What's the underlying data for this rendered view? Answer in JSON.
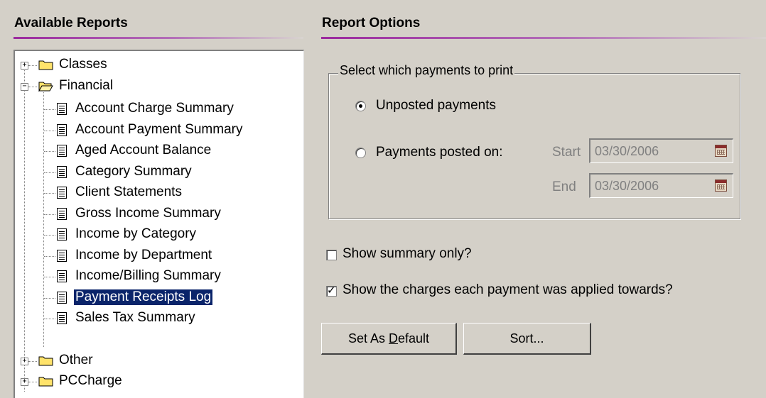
{
  "left_panel": {
    "title": "Available Reports"
  },
  "right_panel": {
    "title": "Report Options"
  },
  "tree": {
    "classes": "Classes",
    "financial": "Financial",
    "financial_items": [
      "Account Charge Summary",
      "Account Payment Summary",
      "Aged Account Balance",
      "Category Summary",
      "Client Statements",
      "Gross Income Summary",
      "Income by Category",
      "Income by Department",
      "Income/Billing Summary",
      "Payment Receipts Log",
      "Sales Tax Summary"
    ],
    "selected": "Payment Receipts Log",
    "other": "Other",
    "pccharge": "PCCharge"
  },
  "payments_group": {
    "title": "Select which payments to print",
    "unposted_label": "Unposted payments",
    "posted_label": "Payments posted on:",
    "selected": "unposted",
    "start_label": "Start",
    "start_value": "03/30/2006",
    "end_label": "End",
    "end_value": "03/30/2006"
  },
  "options": {
    "summary_only_label": "Show summary only?",
    "summary_only_checked": false,
    "show_charges_label": "Show the charges each payment was applied towards?",
    "show_charges_checked": true
  },
  "buttons": {
    "set_default_prefix": "Set As ",
    "set_default_mnemonic": "D",
    "set_default_suffix": "efault",
    "sort": "Sort..."
  },
  "icons": {
    "folder": "folder-icon",
    "folder_open": "folder-open-icon",
    "document": "document-icon",
    "calendar": "calendar-icon"
  },
  "colors": {
    "background": "#d4d0c8",
    "header_accent": "#9b2a9e",
    "selection": "#0a246a"
  }
}
